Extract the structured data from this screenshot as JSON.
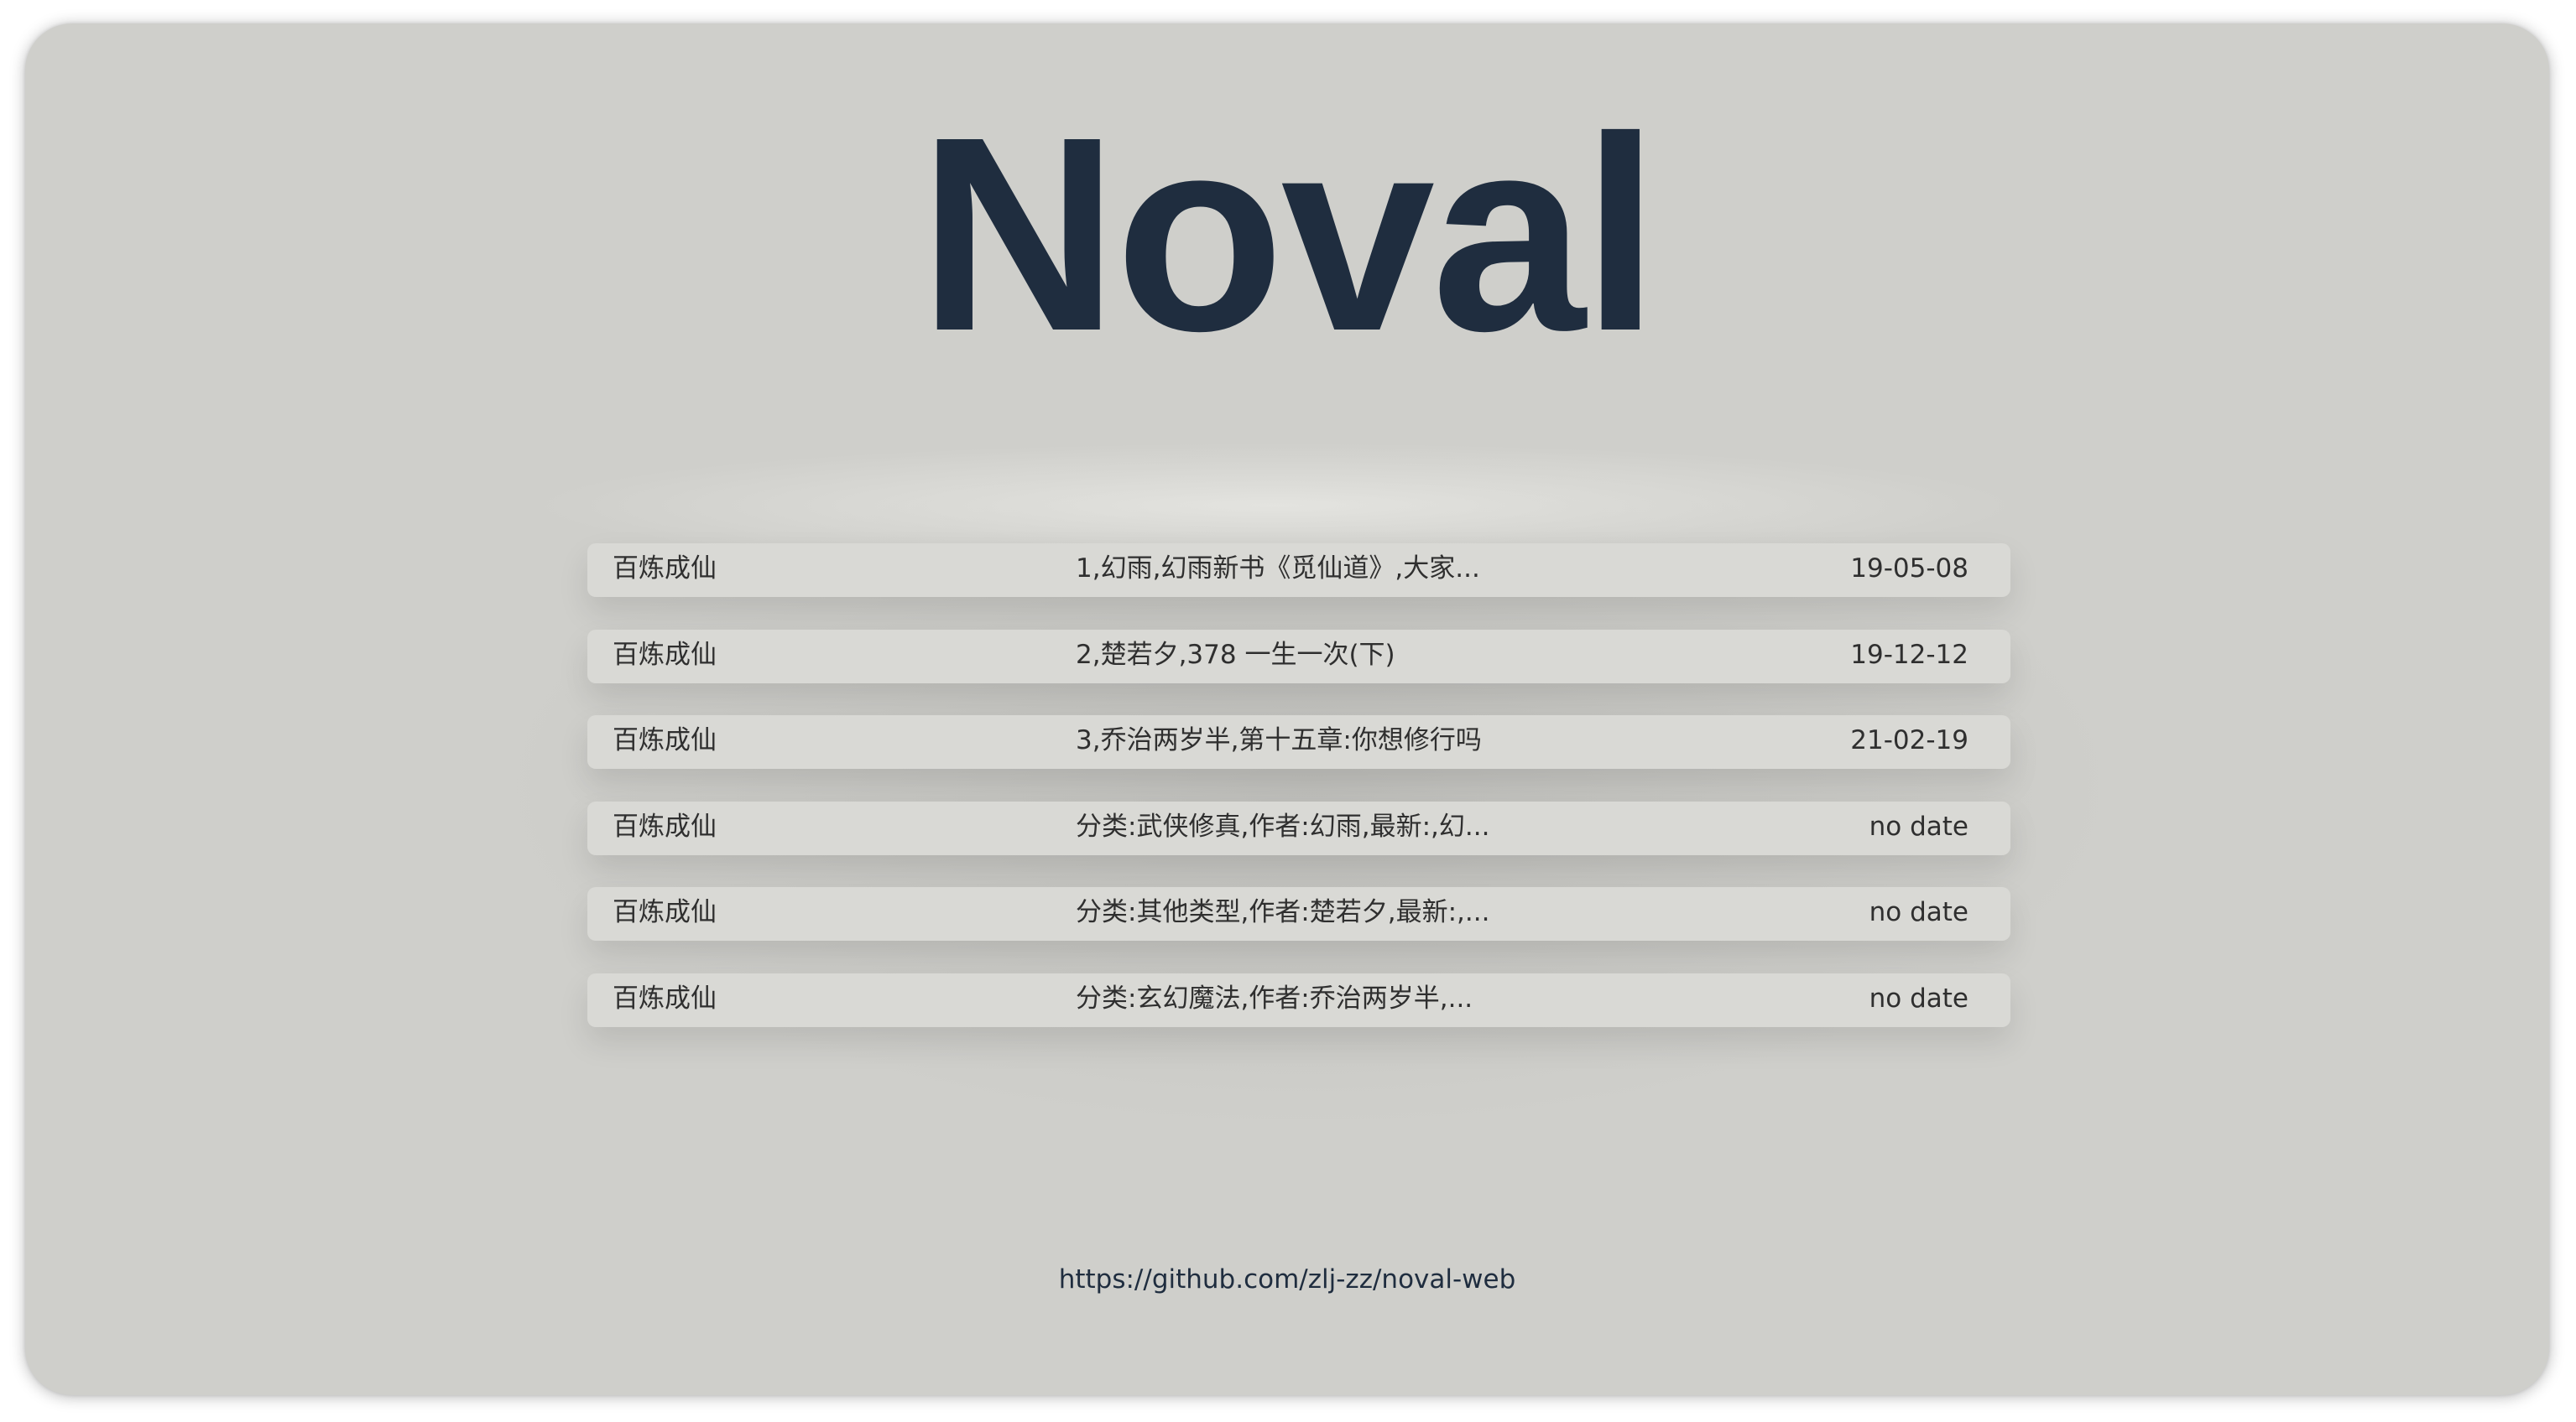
{
  "app": {
    "title": "Noval"
  },
  "novels": [
    {
      "title": "百炼成仙",
      "description": "1,幻雨,幻雨新书《觅仙道》,大家...",
      "date": "19-05-08"
    },
    {
      "title": "百炼成仙",
      "description": "2,楚若夕,378 一生一次(下)",
      "date": "19-12-12"
    },
    {
      "title": "百炼成仙",
      "description": "3,乔治两岁半,第十五章:你想修行吗",
      "date": "21-02-19"
    },
    {
      "title": "百炼成仙",
      "description": "分类:武侠修真,作者:幻雨,最新:,幻...",
      "date": "no date"
    },
    {
      "title": "百炼成仙",
      "description": "分类:其他类型,作者:楚若夕,最新:,...",
      "date": "no date"
    },
    {
      "title": "百炼成仙",
      "description": "分类:玄幻魔法,作者:乔治两岁半,...",
      "date": "no date"
    }
  ],
  "footer": {
    "link": "https://github.com/zlj-zz/noval-web"
  },
  "colors": {
    "background": "#cfcfcb",
    "title": "#1f2d3f",
    "row": "#d9d9d5",
    "text": "#2f2f2f"
  }
}
